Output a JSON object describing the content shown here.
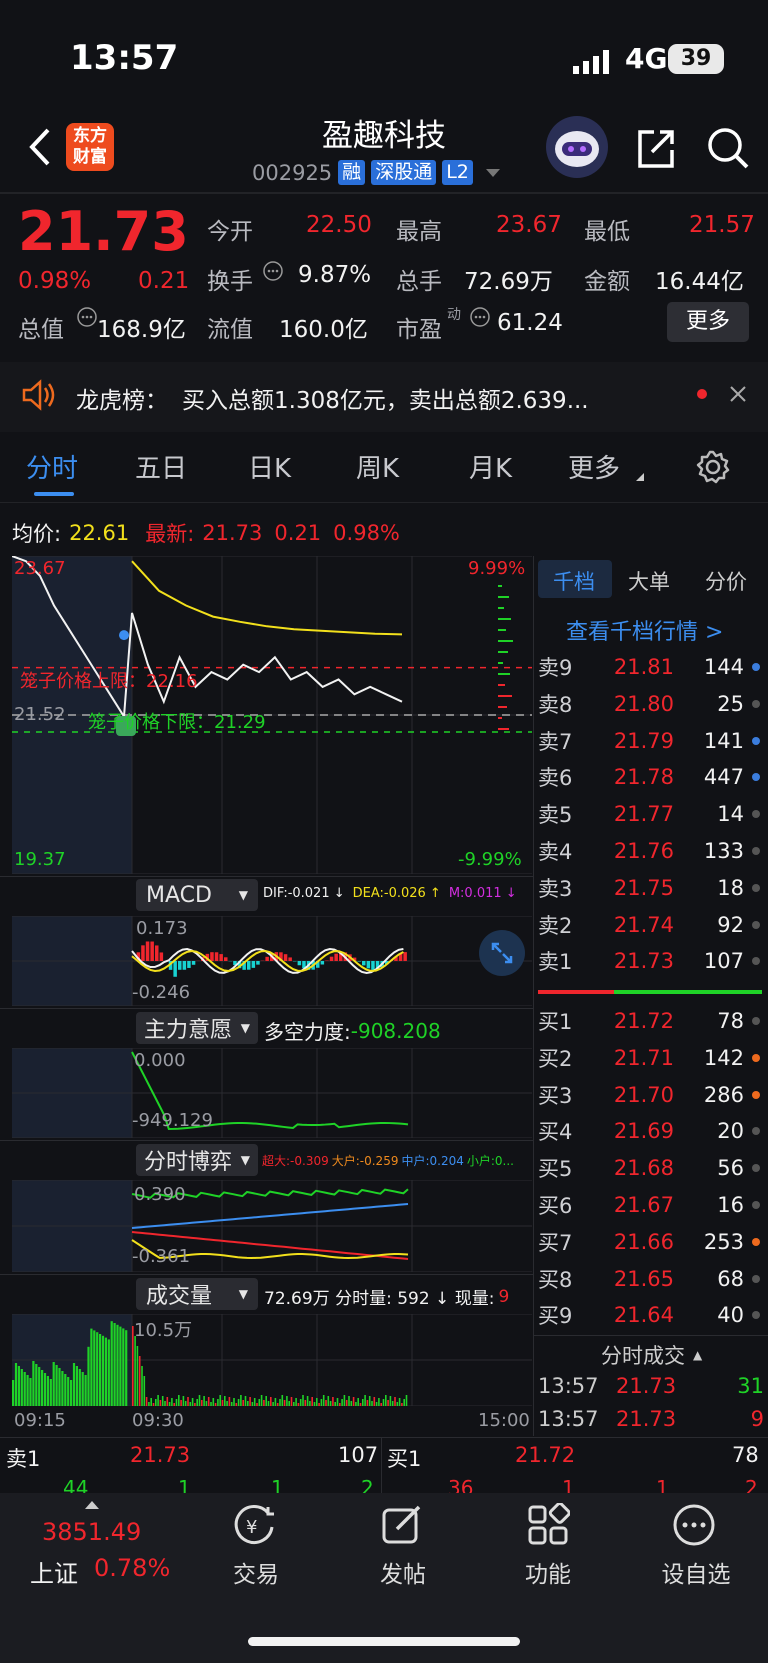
{
  "status": {
    "time": "13:57",
    "network": "4G",
    "battery": "39"
  },
  "header": {
    "logo_line1": "东方",
    "logo_line2": "财富",
    "stock_name": "盈趣科技",
    "stock_code": "002925",
    "tags": [
      "融",
      "深股通",
      "L2"
    ]
  },
  "quote": {
    "price": "21.73",
    "change_pct": "0.98%",
    "change": "0.21",
    "open_label": "今开",
    "open": "22.50",
    "high_label": "最高",
    "high": "23.67",
    "low_label": "最低",
    "low": "21.57",
    "turnover_label": "换手",
    "turnover": "9.87%",
    "volume_label": "总手",
    "volume": "72.69万",
    "amount_label": "金额",
    "amount": "16.44亿",
    "mktcap_label": "总值",
    "mktcap": "168.9亿",
    "float_label": "流值",
    "float": "160.0亿",
    "pe_label": "市盈",
    "pe_sup": "动",
    "pe": "61.24",
    "more": "更多"
  },
  "notice": {
    "title": "龙虎榜：",
    "text": "买入总额1.308亿元，卖出总额2.639..."
  },
  "tabs": [
    "分时",
    "五日",
    "日K",
    "周K",
    "月K",
    "更多"
  ],
  "chart_info": {
    "avg_label": "均价:",
    "avg": "22.61",
    "last_label": "最新:",
    "last": "21.73",
    "chg": "0.21",
    "pct": "0.98%"
  },
  "chart_data": {
    "type": "line",
    "title": "",
    "y_max_label": "23.67",
    "y_min_label": "19.37",
    "pct_max_label": "9.99%",
    "pct_min_label": "-9.99%",
    "prev_close_label": "21.52",
    "ylim": [
      19.37,
      23.67
    ],
    "cage_upper_label": "笼子价格上限：22.16",
    "cage_lower_label": "笼子价格下限：21.29",
    "x_labels": [
      "09:15",
      "09:30",
      "15:00"
    ],
    "series": [
      {
        "values": [
          23.67,
          23.6,
          23.4,
          23.0,
          22.7,
          22.4,
          22.1,
          21.8,
          21.5,
          22.9,
          22.2,
          21.7,
          22.3,
          21.9,
          22.1,
          22.0,
          22.2,
          22.1,
          22.3,
          22.0,
          22.1,
          21.9,
          22.0,
          21.8,
          21.9,
          21.8,
          21.7
        ]
      },
      {
        "values": [
          23.6,
          23.2,
          23.0,
          22.85,
          22.78,
          22.72,
          22.68,
          22.66,
          22.64,
          22.62,
          22.61
        ]
      }
    ]
  },
  "macd": {
    "label": "MACD",
    "dif": "DIF:-0.021 ↓",
    "dea": "DEA:-0.026 ↑",
    "m": "M:0.011 ↓",
    "top": "0.173",
    "bottom": "-0.246"
  },
  "force": {
    "label": "主力意愿",
    "desc_label": "多空力度:",
    "desc_val": "-908.208",
    "top": "0.000",
    "bottom": "-949.129"
  },
  "game": {
    "label": "分时博弈",
    "a": "超大:-0.309",
    "b": "大户:-0.259",
    "c": "中户:0.204",
    "d": "小户:0...",
    "top": "0.390",
    "bottom": "-0.361"
  },
  "vol": {
    "label": "成交量",
    "info": "72.69万 分时量: 592 ↓ 现量:",
    "cur": "9",
    "top": "10.5万"
  },
  "side": {
    "tabs": [
      "千档",
      "大单",
      "分价"
    ],
    "link": "查看千档行情 >"
  },
  "asks": [
    {
      "l": "卖9",
      "p": "21.81",
      "v": "144",
      "dot": "#3b7ddd"
    },
    {
      "l": "卖8",
      "p": "21.80",
      "v": "25",
      "dot": "#555"
    },
    {
      "l": "卖7",
      "p": "21.79",
      "v": "141",
      "dot": "#3b7ddd"
    },
    {
      "l": "卖6",
      "p": "21.78",
      "v": "447",
      "dot": "#3b7ddd"
    },
    {
      "l": "卖5",
      "p": "21.77",
      "v": "14",
      "dot": "#555"
    },
    {
      "l": "卖4",
      "p": "21.76",
      "v": "133",
      "dot": "#555"
    },
    {
      "l": "卖3",
      "p": "21.75",
      "v": "18",
      "dot": "#555"
    },
    {
      "l": "卖2",
      "p": "21.74",
      "v": "92",
      "dot": "#555"
    },
    {
      "l": "卖1",
      "p": "21.73",
      "v": "107",
      "dot": "#555"
    }
  ],
  "bids": [
    {
      "l": "买1",
      "p": "21.72",
      "v": "78",
      "dot": "#555"
    },
    {
      "l": "买2",
      "p": "21.71",
      "v": "142",
      "dot": "#ee6a1e"
    },
    {
      "l": "买3",
      "p": "21.70",
      "v": "286",
      "dot": "#ee6a1e"
    },
    {
      "l": "买4",
      "p": "21.69",
      "v": "20",
      "dot": "#555"
    },
    {
      "l": "买5",
      "p": "21.68",
      "v": "56",
      "dot": "#555"
    },
    {
      "l": "买6",
      "p": "21.67",
      "v": "16",
      "dot": "#555"
    },
    {
      "l": "买7",
      "p": "21.66",
      "v": "253",
      "dot": "#ee6a1e"
    },
    {
      "l": "买8",
      "p": "21.65",
      "v": "68",
      "dot": "#555"
    },
    {
      "l": "买9",
      "p": "21.64",
      "v": "40",
      "dot": "#555"
    }
  ],
  "ticks": {
    "title": "分时成交",
    "rows": [
      {
        "t": "13:57",
        "p": "21.73",
        "v": "31"
      },
      {
        "t": "13:57",
        "p": "21.73",
        "v": "9"
      }
    ]
  },
  "bottom_quote": {
    "sell_label": "卖1",
    "sell_price": "21.73",
    "sell_vol": "107",
    "buy_label": "买1",
    "buy_price": "21.72",
    "buy_vol": "78",
    "left_nums": [
      "44",
      "1",
      "1",
      "2"
    ],
    "right_nums": [
      "36",
      "1",
      "1",
      "2"
    ]
  },
  "nav": {
    "index_value": "3851.49",
    "index_name": "上证",
    "index_pct": "0.78%",
    "items": [
      "交易",
      "发帖",
      "功能",
      "设自选"
    ]
  }
}
